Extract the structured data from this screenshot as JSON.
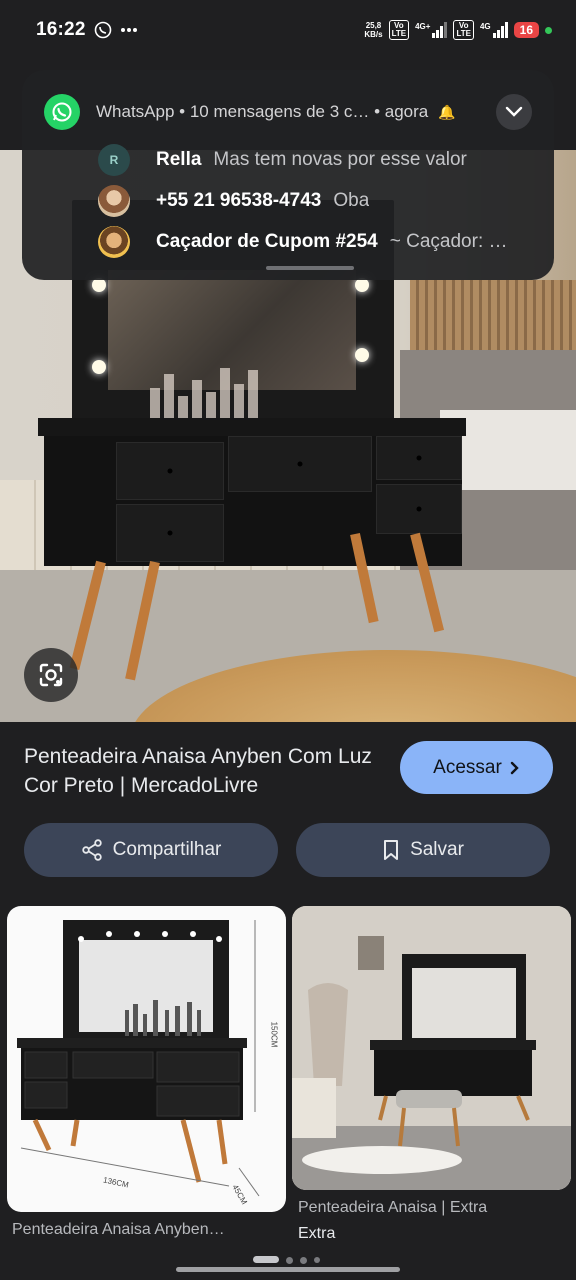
{
  "status_bar": {
    "time": "16:22",
    "net_speed_value": "25,8",
    "net_speed_unit": "KB/s",
    "sim1_badge_top": "Vo",
    "sim1_badge_bottom": "LTE",
    "sim1_network": "4G+",
    "sim2_badge_top": "Vo",
    "sim2_badge_bottom": "LTE",
    "sim2_network": "4G",
    "battery": "16"
  },
  "notification": {
    "app_line": "WhatsApp • 10 mensagens de 3 c… • agora",
    "messages": [
      {
        "avatar_letter": "R",
        "sender": "Rella",
        "text": "Mas tem novas por esse valor"
      },
      {
        "avatar_letter": "",
        "sender": "+55 21 96538-4743",
        "text": "Oba"
      },
      {
        "avatar_letter": "",
        "sender": "Caçador de Cupom #254",
        "text": "~ Caçador: …"
      }
    ]
  },
  "result": {
    "title": "Penteadeira Anaisa Anyben Com Luz Cor Preto | MercadoLivre",
    "visit_label": "Acessar",
    "share_label": "Compartilhar",
    "save_label": "Salvar"
  },
  "related": [
    {
      "caption": "Penteadeira Anaisa Anyben…",
      "dim_height": "150CM",
      "dim_width": "136CM",
      "dim_depth": "45CM"
    },
    {
      "caption": "Penteadeira Anaisa | Extra",
      "source": "Extra"
    }
  ],
  "colors": {
    "background": "#1f1f21",
    "accent_button": "#8ab4f8",
    "secondary_button": "#3c4558",
    "whatsapp_green": "#25d366",
    "battery_low": "#e94545"
  },
  "icons": {
    "chat": "whatsapp-icon",
    "more": "more-dots-icon",
    "share": "share-icon",
    "save": "bookmark-icon",
    "visit": "chevron-right-icon",
    "lens": "lens-icon"
  }
}
